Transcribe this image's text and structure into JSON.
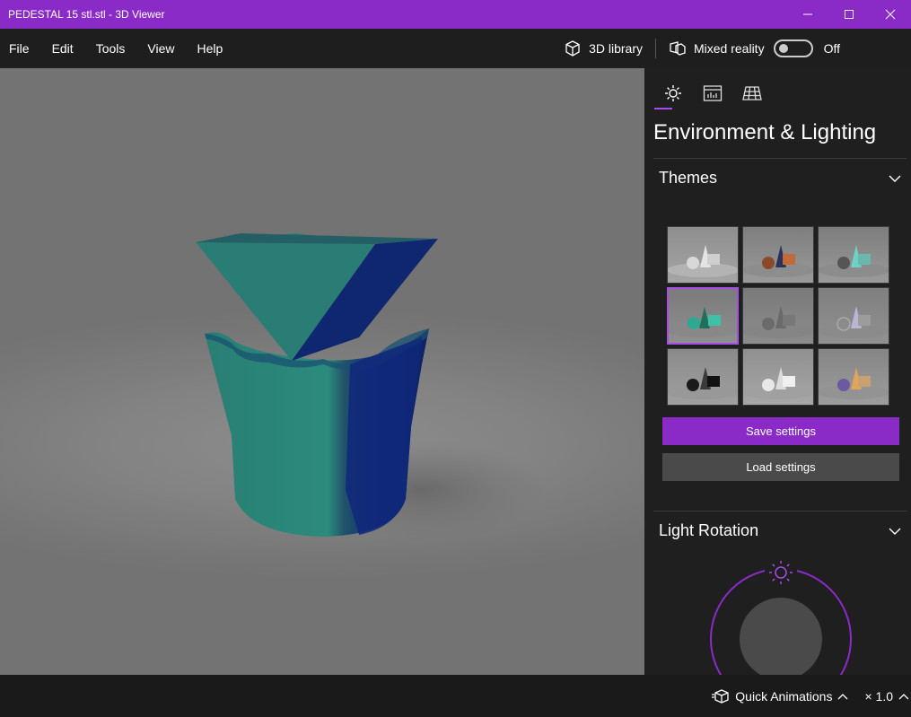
{
  "window": {
    "title": "PEDESTAL 15 stl.stl - 3D Viewer",
    "accent_color": "#8a2bc8"
  },
  "menu": {
    "items": [
      {
        "label": "File"
      },
      {
        "label": "Edit"
      },
      {
        "label": "Tools"
      },
      {
        "label": "View"
      },
      {
        "label": "Help"
      }
    ],
    "library_label": "3D library",
    "mixed_reality_label": "Mixed reality",
    "mixed_reality_state": "Off"
  },
  "panel": {
    "tabs": [
      {
        "icon": "sun-icon",
        "active": true
      },
      {
        "icon": "stats-icon",
        "active": false
      },
      {
        "icon": "grid-icon",
        "active": false
      }
    ],
    "title": "Environment & Lighting",
    "themes_label": "Themes",
    "selected_theme_index": 3,
    "save_label": "Save settings",
    "load_label": "Load settings",
    "light_rotation_label": "Light Rotation"
  },
  "bottom": {
    "quick_animations_label": "Quick Animations",
    "speed_label": "× 1.0"
  }
}
